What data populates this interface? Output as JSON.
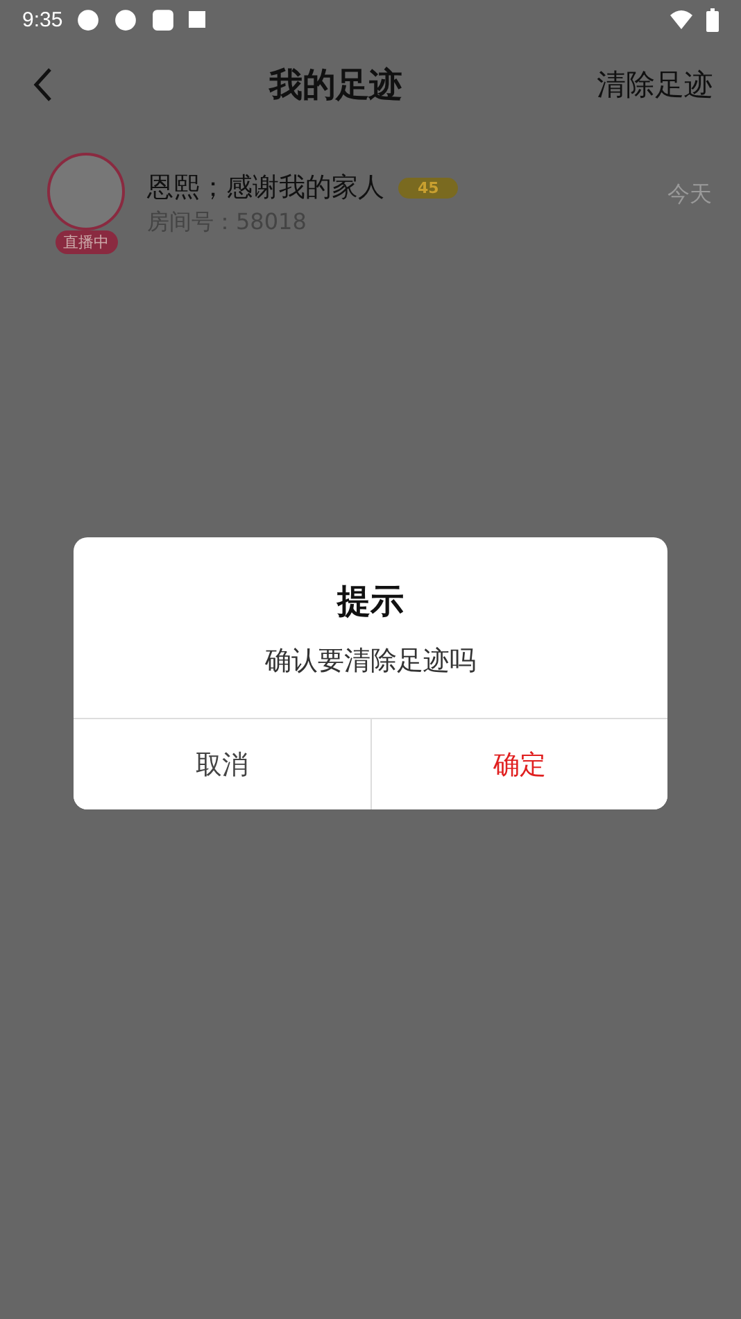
{
  "status_bar": {
    "time": "9:35"
  },
  "header": {
    "title": "我的足迹",
    "action": "清除足迹"
  },
  "records": [
    {
      "name": "恩熙；感谢我的家人",
      "level_badge": "45",
      "room": "房间号：58018",
      "date": "今天",
      "live": true,
      "live_label": "直播中"
    }
  ],
  "dialog": {
    "title": "提示",
    "message": "确认要清除足迹吗",
    "buttons": [
      {
        "label": "取消",
        "kind": "cancel"
      },
      {
        "label": "确定",
        "kind": "confirm"
      }
    ]
  }
}
